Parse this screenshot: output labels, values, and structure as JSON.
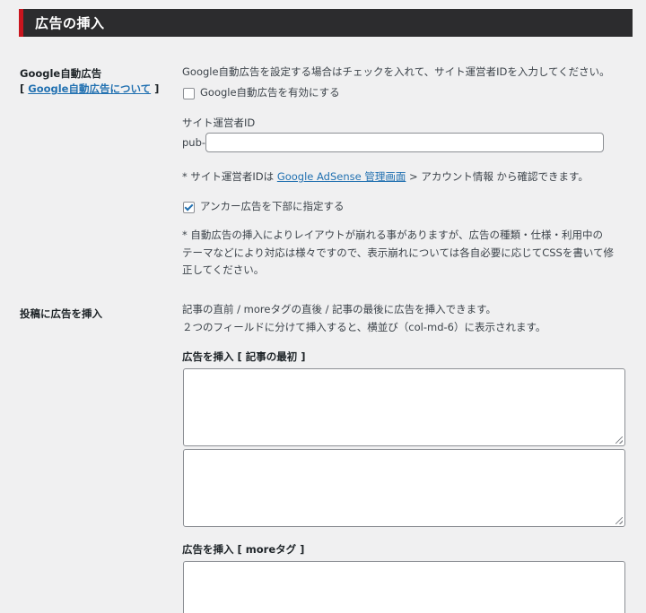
{
  "header": {
    "title": "広告の挿入"
  },
  "auto_ads": {
    "label": "Google自動広告",
    "link_prefix": "[ ",
    "link_text": "Google自動広告について",
    "link_suffix": " ]",
    "description": "Google自動広告を設定する場合はチェックを入れて、サイト運営者IDを入力してください。",
    "enable_label": "Google自動広告を有効にする",
    "enable_checked": false,
    "publisher_id_label": "サイト運営者ID",
    "publisher_prefix": "pub-",
    "publisher_value": "",
    "note_prefix": "* サイト運営者IDは ",
    "note_link": "Google AdSense 管理画面",
    "note_suffix": " > アカウント情報 から確認できます。",
    "anchor_label": "アンカー広告を下部に指定する",
    "anchor_checked": true,
    "warning_lines": [
      "* 自動広告の挿入によりレイアウトが崩れる事がありますが、広告の種類・仕様・利用中の",
      "テーマなどにより対応は様々ですので、表示崩れについては各自必要に応じてCSSを書いて修",
      "正してください。"
    ]
  },
  "post_ads": {
    "label": "投稿に広告を挿入",
    "description_lines": [
      "記事の直前 / moreタグの直後 / 記事の最後に広告を挿入できます。",
      "２つのフィールドに分けて挿入すると、横並び（col-md-6）に表示されます。"
    ],
    "section_top_label": "広告を挿入 [ 記事の最初 ]",
    "section_more_label": "広告を挿入 [ moreタグ ]"
  }
}
